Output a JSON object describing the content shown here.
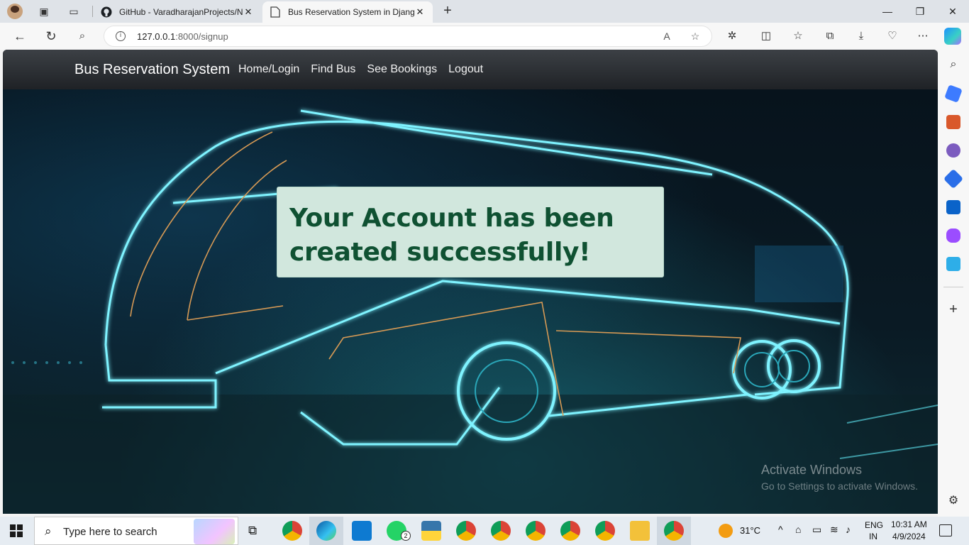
{
  "browser": {
    "tabs": [
      {
        "title": "GitHub - VaradharajanProjects/N",
        "active": false,
        "icon": "github-icon"
      },
      {
        "title": "Bus Reservation System in Djang",
        "active": true,
        "icon": "page-icon"
      }
    ],
    "address": {
      "host": "127.0.0.1",
      "path": ":8000/signup"
    }
  },
  "page": {
    "brand": "Bus Reservation System",
    "nav": [
      "Home/Login",
      "Find Bus",
      "See Bookings",
      "Logout"
    ],
    "alert": {
      "line1": "Your Account has been",
      "line2": "created successfully!",
      "color": "#0f5132",
      "background": "#d1e7dd"
    }
  },
  "watermark": {
    "title": "Activate Windows",
    "subtitle": "Go to Settings to activate Windows."
  },
  "taskbar": {
    "search_placeholder": "Type here to search",
    "weather": "31°C",
    "lang1": "ENG",
    "lang2": "IN",
    "time": "10:31 AM",
    "date": "4/9/2024",
    "whatsapp_badge": "2"
  }
}
